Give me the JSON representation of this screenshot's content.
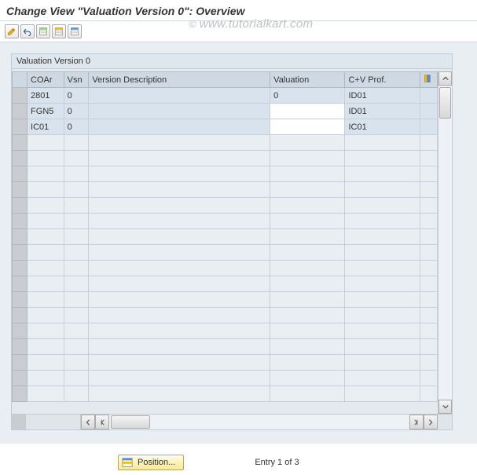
{
  "header": {
    "title": "Change View \"Valuation Version 0\": Overview"
  },
  "watermark": {
    "copyright": "©",
    "text": "www.tutorialkart.com"
  },
  "toolbar": {
    "icons": {
      "change": "change-icon",
      "undo": "undo-icon",
      "select_all": "select-all-icon",
      "save": "save-icon",
      "deselect": "deselect-icon"
    }
  },
  "grid": {
    "title": "Valuation Version 0",
    "columns": {
      "sel": "",
      "coar": "COAr",
      "vsn": "Vsn",
      "version_description": "Version Description",
      "valuation": "Valuation",
      "cv_prof": "C+V Prof.",
      "config": ""
    },
    "rows": [
      {
        "coar": "2801",
        "vsn": "0",
        "version_description": "",
        "valuation": "0",
        "cv_prof": "ID01",
        "valuation_editable": false
      },
      {
        "coar": "FGN5",
        "vsn": "0",
        "version_description": "",
        "valuation": "",
        "cv_prof": "ID01",
        "valuation_editable": true
      },
      {
        "coar": "IC01",
        "vsn": "0",
        "version_description": "",
        "valuation": "",
        "cv_prof": "IC01",
        "valuation_editable": true
      }
    ],
    "empty_row_count": 17
  },
  "footer": {
    "position_label": "Position...",
    "entry_label": "Entry 1 of 3"
  }
}
